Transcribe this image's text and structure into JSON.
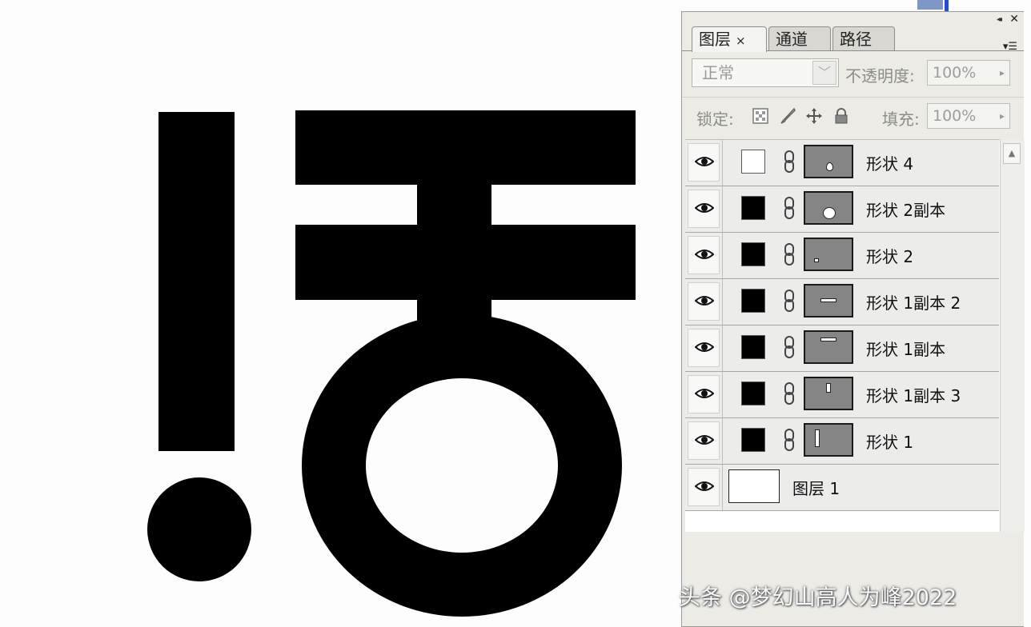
{
  "panel": {
    "tabs": [
      {
        "label": "图层",
        "close": "×"
      },
      {
        "label": "通道"
      },
      {
        "label": "路径"
      }
    ],
    "close_button": "✕",
    "collapse_button": "◂◂",
    "menu_button": "▾☰",
    "blend_mode": "正常",
    "opacity_label": "不透明度:",
    "opacity_value": "100%",
    "lock_label": "锁定:",
    "fill_label": "填充:",
    "fill_value": "100%",
    "lock_icons": [
      "lock-transparent-icon",
      "lock-image-brush-icon",
      "lock-position-move-icon",
      "lock-all-icon"
    ],
    "layers": [
      {
        "name": "形状 4",
        "mask": "white",
        "thumb": "drop"
      },
      {
        "name": "形状 2副本",
        "mask": "black",
        "thumb": "circle"
      },
      {
        "name": "形状 2",
        "mask": "black",
        "thumb": "dot"
      },
      {
        "name": "形状 1副本 2",
        "mask": "black",
        "thumb": "hbar"
      },
      {
        "name": "形状 1副本",
        "mask": "black",
        "thumb": "hbar-top"
      },
      {
        "name": "形状 1副本 3",
        "mask": "black",
        "thumb": "vbar-small"
      },
      {
        "name": "形状 1",
        "mask": "black",
        "thumb": "vbar"
      },
      {
        "name": "图层 1",
        "type": "background"
      }
    ]
  },
  "watermark": "头条 @梦幻山高人为峰2022",
  "colors": {
    "panel_bg": "#ecebe6",
    "artwork": "#000000",
    "canvas": "#fdfdfd"
  }
}
